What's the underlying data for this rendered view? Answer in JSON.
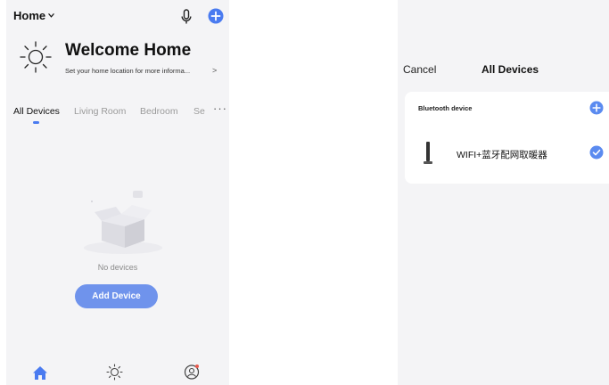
{
  "home_screen": {
    "home_title": "Home",
    "welcome_title": "Welcome Home",
    "welcome_subtitle": "Set your home location for more informa...",
    "welcome_arrow": ">",
    "tabs": [
      {
        "label": "All Devices",
        "active": true
      },
      {
        "label": "Living Room",
        "active": false
      },
      {
        "label": "Bedroom",
        "active": false
      },
      {
        "label": "Se",
        "active": false
      }
    ],
    "more_label": "···",
    "empty_text": "No devices",
    "add_device_label": "Add Device",
    "bottom_nav": [
      "home-icon",
      "sun-icon",
      "profile-icon"
    ],
    "accent_color": "#4a7bf0",
    "button_color": "#6f93ec"
  },
  "device_screen": {
    "cancel_label": "Cancel",
    "title": "All Devices",
    "section_label": "Bluetooth device",
    "device_name": "WIFI+蓝牙配网取暖器",
    "device_selected": true,
    "accent_color": "#5b8bf0"
  }
}
